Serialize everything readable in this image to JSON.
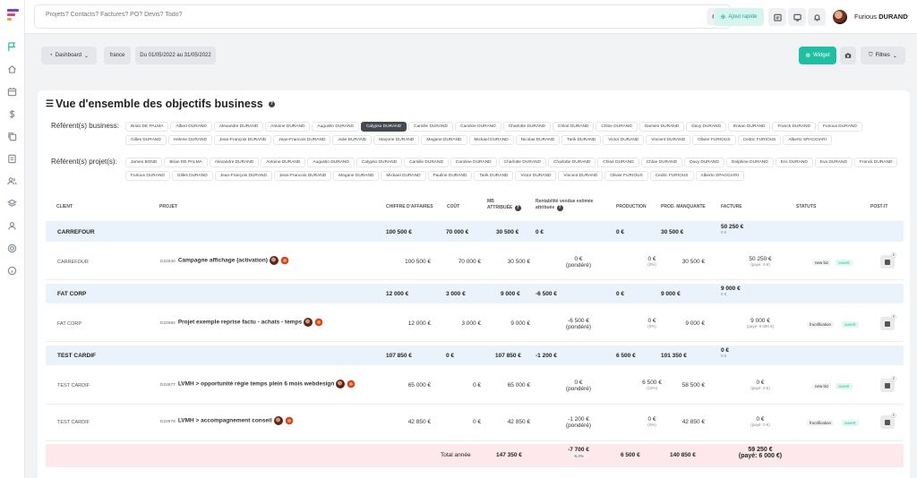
{
  "topbar": {
    "search_placeholder": "Projets? Contacts? Factures? PO? Devis? Todo?",
    "quick_add_label": "Ajout rapide",
    "user_first": "Furious",
    "user_last": "DURAND"
  },
  "filters": {
    "dashboard": "Dashboard",
    "country": "france",
    "period": "Du 01/05/2022 au 31/05/2022",
    "widget": "Widget",
    "filtres": "Filtres"
  },
  "card": {
    "title": "Vue d'ensemble des objectifs business",
    "ref_business_label": "Référent(s) business:",
    "ref_business": [
      "Brian DE PALMA",
      "Albert DURAND",
      "Alexandre DURAND",
      "Antoine DURAND",
      "Augustin DURAND",
      "Calypso DURAND",
      "Camille DURAND",
      "Caroline DURAND",
      "Charlotte DURAND",
      "Chloé DURAND",
      "Chloe DURAND",
      "Damien DURAND",
      "Davy DURAND",
      "Erwan DURAND",
      "Franck DURAND",
      "Furious DURAND",
      "Gilles DURAND",
      "Helene DURAND",
      "Jean-François DURAND",
      "Jean-Francois DURAND",
      "Julie DURAND",
      "Marjorie DURAND",
      "Megane DURAND",
      "Mickael DURAND",
      "Nicolas DURAND",
      "Tarik DURAND",
      "Victor DURAND",
      "Vincent DURAND",
      "Olivier FURIOUS",
      "Cedric FURIOUS",
      "Alberto SPAGGIARI"
    ],
    "ref_business_selected": 5,
    "ref_projet_label": "Référent(s) projet(s):",
    "ref_projet": [
      "James BOND",
      "Brian DE PALMA",
      "Alexandre DURAND",
      "Antoine DURAND",
      "Augustin DURAND",
      "Calypso DURAND",
      "Camille DURAND",
      "Caroline DURAND",
      "Charlotte DURAND",
      "Charlotte DURAND",
      "Chloé DURAND",
      "Chloe DURAND",
      "Davy DURAND",
      "Delphine DURAND",
      "Eric DURAND",
      "Eva DURAND",
      "Franck DURAND",
      "Furious DURAND",
      "Gilles DURAND",
      "Jean-François DURAND",
      "Jean-Francois DURAND",
      "Megane DURAND",
      "Mickael DURAND",
      "Pauline DURAND",
      "Tarik DURAND",
      "Victor DURAND",
      "Vincent DURAND",
      "Olivier FURIOUS",
      "Cedric FURIOUS",
      "Alberto SPAGGIARI"
    ]
  },
  "table": {
    "headers": {
      "client": "Client",
      "projet": "Projet",
      "ca": "Chiffre d'affaires",
      "cout": "Coût",
      "mb1": "MB",
      "mb2": "attribuée",
      "rent1": "Rentabilité vendue estimée",
      "rent2": "attribuée",
      "production": "Production",
      "prod_manquante": "Prod. manquante",
      "facture": "Facture",
      "statuts": "Statuts",
      "postit": "Post-it"
    },
    "groups": [
      {
        "name": "CARREFOUR",
        "ca": "100 500 €",
        "cout": "70 000 €",
        "mb": "30 500 €",
        "rent": "0 €",
        "prod": "0 €",
        "manq": "30 500 €",
        "fact": "50 250 €",
        "fact_sub": "0 €",
        "lines": [
          {
            "client": "CARREFOUR",
            "code": "D22640",
            "name": "Campagne affichage (activation)",
            "ca": "100 500 €",
            "cout": "70 000 €",
            "mb": "30 500 €",
            "rent": "0 €",
            "rent_sub": "(pondéré)",
            "prod": "0 €",
            "prod_sub": "(0%)",
            "manq": "30 500 €",
            "fact": "50 250 €",
            "fact_sub": "(payé: 0 €)",
            "status": "new biz",
            "state": "ouvert",
            "postit": "0"
          }
        ]
      },
      {
        "name": "FAT CORP",
        "ca": "12 000 €",
        "cout": "3 000 €",
        "mb": "9 000 €",
        "rent": "-6 500 €",
        "prod": "0 €",
        "manq": "9 000 €",
        "fact": "9 000 €",
        "fact_sub": "0 €",
        "lines": [
          {
            "client": "FAT CORP",
            "code": "D22692",
            "name": "Projet exemple reprise factu - achats - temps",
            "ca": "12 000 €",
            "cout": "3 000 €",
            "mb": "9 000 €",
            "rent": "-6 500 €",
            "rent_sub": "(pondéré)",
            "prod": "0 €",
            "prod_sub": "(0%)",
            "manq": "9 000 €",
            "fact": "9 000 €",
            "fact_sub": "(payé: 9 000 €)",
            "status": "fructification",
            "state": "ouvert",
            "postit": "0"
          }
        ]
      },
      {
        "name": "TEST CARDIF",
        "ca": "107 850 €",
        "cout": "0 €",
        "mb": "107 850 €",
        "rent": "-1 200 €",
        "prod": "6 500 €",
        "manq": "101 350 €",
        "fact": "0 €",
        "fact_sub": "0 €",
        "lines": [
          {
            "client": "TEST CARDIF",
            "code": "D22677",
            "name": "LVMH > opportunité régie temps plein 6 mois webdesign",
            "ca": "65 000 €",
            "cout": "0 €",
            "mb": "65 000 €",
            "rent": "0 €",
            "rent_sub": "(pondéré)",
            "prod": "6 500 €",
            "prod_sub": "(10%)",
            "manq": "58 500 €",
            "fact": "0 €",
            "fact_sub": "(payé: 0 €)",
            "status": "new biz",
            "state": "ouvert",
            "postit": "0"
          },
          {
            "client": "TEST CARDIF",
            "code": "D22678",
            "name": "LVMH > accompagnement conseil",
            "ca": "42 850 €",
            "cout": "0 €",
            "mb": "42 850 €",
            "rent": "-1 200 €",
            "rent_sub": "(pondéré)",
            "prod": "0 €",
            "prod_sub": "(0%)",
            "manq": "42 850 €",
            "fact": "0 €",
            "fact_sub": "(payé: 0 €)",
            "status": "fructification",
            "state": "ouvert",
            "postit": "0"
          }
        ]
      }
    ],
    "total": {
      "label": "Total année",
      "mb": "147 350 €",
      "rent": "-7 700 €",
      "rent_pct": "-5.2%",
      "prod": "6 500 €",
      "manq": "140 850 €",
      "fact": "59 250 €",
      "fact_sub": "(payé: 6 000 €)"
    }
  }
}
